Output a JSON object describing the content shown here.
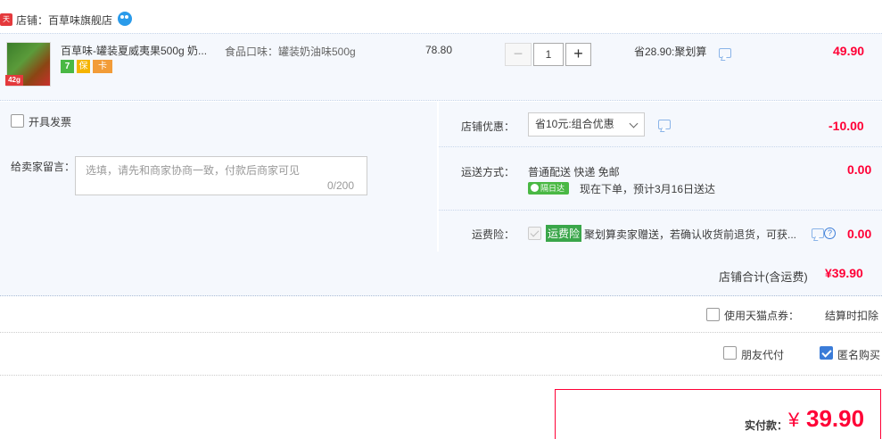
{
  "shop": {
    "badge": "天猫",
    "label": "店铺：百草味旗舰店",
    "chat_icon": "wangwang-icon"
  },
  "item": {
    "thumb_badge": "42g",
    "title": "百草味-罐装夏威夷果500g 奶...",
    "service_icons": [
      "7",
      "保",
      "卡"
    ],
    "sku": "食品口味：罐装奶油味500g",
    "price": "78.80",
    "qty_minus": "−",
    "quantity": "1",
    "qty_plus": "+",
    "discount": "省28.90:聚划算",
    "subtotal": "49.90"
  },
  "invoice": {
    "label": "开具发票"
  },
  "message": {
    "label": "给卖家留言：",
    "placeholder": "选填，请先和商家协商一致，付款后商家可见",
    "count": "0/200"
  },
  "coupon": {
    "label": "店铺优惠：",
    "selected": "省10元:组合优惠",
    "amount": "-10.00"
  },
  "shipping": {
    "label": "运送方式：",
    "method": "普通配送 快递 免邮",
    "tag": "隔日达",
    "eta": "现在下单，预计3月16日送达",
    "amount": "0.00"
  },
  "insurance": {
    "label": "运费险：",
    "tag": "运费险",
    "text": "聚划算卖家赠送，若确认收货前退货，可获...",
    "amount": "0.00"
  },
  "shop_total": {
    "label": "店铺合计(含运费)",
    "amount": "¥39.90"
  },
  "points": {
    "label": "使用天猫点券：",
    "note": "结算时扣除"
  },
  "options": {
    "friend_pay": "朋友代付",
    "anonymous": "匿名购买"
  },
  "pay": {
    "label": "实付款：",
    "currency": "¥",
    "amount": "39.90"
  },
  "colors": {
    "accent_red": "#ff0036",
    "panel_bg": "#f5f8fd",
    "checkbox_blue": "#3b7cd8",
    "tag_green": "#4ab844"
  }
}
